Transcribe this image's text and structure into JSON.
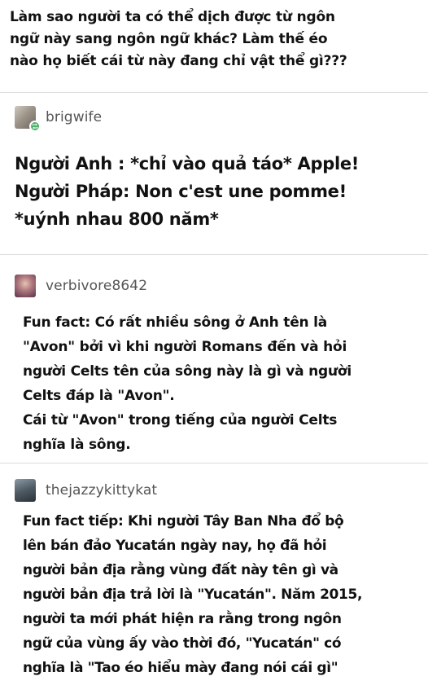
{
  "question": {
    "text": "Làm sao người ta có thể dịch được từ ngôn\nngữ này sang ngôn ngữ khác? Làm thế éo\nnào họ biết cái từ này đang chỉ vật thể gì???"
  },
  "replies": [
    {
      "username": "brigwife",
      "avatar_icon": "avatar-brigwife-icon",
      "text": "Người Anh : *chỉ vào quả táo* Apple!\nNgười Pháp: Non c'est une pomme!\n*uýnh nhau 800 năm*"
    },
    {
      "username": "verbivore8642",
      "avatar_icon": "avatar-verbivore8642-icon",
      "text": "Fun fact: Có rất nhiều sông ở Anh tên là\n\"Avon\" bởi vì khi người Romans đến và hỏi\nngười Celts tên của sông này là gì và người\nCelts đáp là \"Avon\".\nCái từ \"Avon\" trong tiếng của người Celts\nnghĩa là sông."
    },
    {
      "username": "thejazzykittykat",
      "avatar_icon": "avatar-thejazzykittykat-icon",
      "text": "Fun fact tiếp: Khi người Tây Ban Nha đổ bộ\nlên bán đảo Yucatán ngày nay, họ đã hỏi\nngười bản địa rằng vùng đất này tên gì và\nngười bản địa trả lời là \"Yucatán\". Năm 2015,\nngười ta mới phát hiện ra rằng trong ngôn\nngữ của vùng ấy vào thời đó, \"Yucatán\" có\nnghĩa là \"Tao éo hiểu mày đang nói cái gì\""
    }
  ],
  "colors": {
    "text": "#111111",
    "username": "#555555",
    "divider": "#dcdcdc",
    "reblog_badge": "#4caf6b"
  }
}
